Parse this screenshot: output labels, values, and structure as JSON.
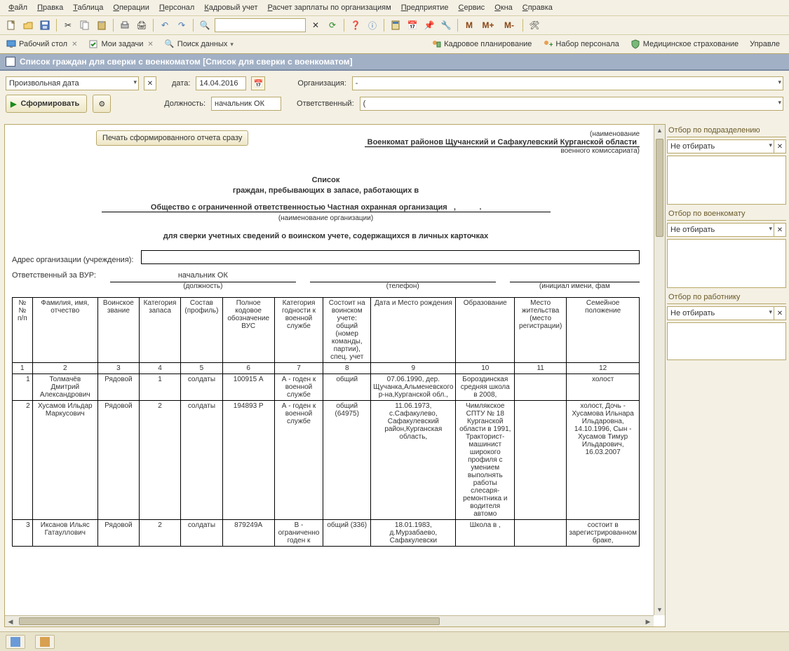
{
  "menu": [
    "Файл",
    "Правка",
    "Таблица",
    "Операции",
    "Персонал",
    "Кадровый учет",
    "Расчет зарплаты по организациям",
    "Предприятие",
    "Сервис",
    "Окна",
    "Справка"
  ],
  "nav": {
    "desktop": "Рабочий стол",
    "tasks": "Мои задачи",
    "search": "Поиск данных",
    "hr_plan": "Кадровое планирование",
    "recruit": "Набор персонала",
    "med": "Медицинское страхование",
    "manage": "Управле"
  },
  "tab_title": "Список граждан для сверки с военкоматом [Список для сверки с военкоматом]",
  "form": {
    "period_mode": "Произвольная дата",
    "date_label": "дата:",
    "date_value": "14.04.2016",
    "org_label": "Организация:",
    "org_value": "-",
    "position_label": "Должность:",
    "position_value": "начальник ОК",
    "responsible_label": "Ответственный:",
    "responsible_value": "(",
    "generate": "Сформировать",
    "print_immediately": "Печать сформированного отчета сразу"
  },
  "report": {
    "hdr_top": "(наименование",
    "hdr_main": "Военкомат районов Щучанский и Сафакулевский Курганской области",
    "hdr_sub": "военного комиссариата)",
    "title1": "Список",
    "title2": "граждан, пребывающих в запасе, работающих в",
    "org_line": "Общество с ограниченной ответственностью Частная охранная организация",
    "org_sub": "(наименование организации)",
    "title3": "для сверки учетных сведений о воинском учете, содержащихся в личных карточках",
    "addr_label": "Адрес организации (учреждения):",
    "addr_value": "",
    "resp_label": "Ответственный за ВУР:",
    "resp_position": "начальник ОК",
    "resp_position_lbl": "(должность)",
    "resp_phone_lbl": "(телефон)",
    "resp_fio_lbl": "(инициал имени, фам",
    "cols": {
      "n": "№ № п/п",
      "fio": "Фамилия, имя, отчество",
      "rank": "Воинское звание",
      "cat": "Категория запаса",
      "staff": "Состав (профиль)",
      "vus": "Полное кодовое обозначение ВУС",
      "fit": "Категория годности к военной службе",
      "account": "Состоит на воинском учете: общий (номер команды, партии), спец. учет",
      "birth": "Дата и Место рождения",
      "edu": "Образование",
      "residence": "Место жительства (место регистрации)",
      "family": "Семейное положение"
    },
    "colnums": [
      "1",
      "2",
      "3",
      "4",
      "5",
      "6",
      "7",
      "8",
      "9",
      "10",
      "11",
      "12"
    ],
    "rows": [
      {
        "n": "1",
        "fio": "Толмачёв Дмитрий Александрович",
        "rank": "Рядовой",
        "cat": "1",
        "staff": "солдаты",
        "vus": "100915 А",
        "fit": "А - годен к военной службе",
        "account": "общий",
        "birth": "07.06.1990, дер. Щучанка,Альменевского р-на,Курганской обл.,",
        "edu": "Бороздинская средняя школа в 2008,",
        "residence": "",
        "family": "холост"
      },
      {
        "n": "2",
        "fio": "Хусамов Ильдар Маркусович",
        "rank": "Рядовой",
        "cat": "2",
        "staff": "солдаты",
        "vus": "194893 Р",
        "fit": "А - годен к военной службе",
        "account": "общий (64975)",
        "birth": "11.06.1973, с.Сафакулево, Сафакулевский район,Курганская область,",
        "edu": "Чимлякское СПТУ № 18 Курганской области в 1991, Тракторист-машинист широкого профиля с умением выполнять работы слесаря-ремонтника и водителя автомо",
        "residence": "",
        "family": "холост, Дочь - Хусамова Ильнара Ильдаровна, 14.10.1996, Сын - Хусамов Тимур Ильдарович, 16.03.2007"
      },
      {
        "n": "3",
        "fio": "Иксанов Ильяс Гатауллович",
        "rank": "Рядовой",
        "cat": "2",
        "staff": "солдаты",
        "vus": "879249А",
        "fit": "В - ограниченно годен к",
        "account": "общий (336)",
        "birth": "18.01.1983, д.Мурзабаево, Сафакулевски",
        "edu": "Школа в ,",
        "residence": "",
        "family": "состоит в зарегистрированном браке,"
      }
    ]
  },
  "side": {
    "g1_title": "Отбор по подразделению",
    "g2_title": "Отбор по военкомату",
    "g3_title": "Отбор по работнику",
    "no_filter": "Не отбирать"
  },
  "toolbar_m": {
    "m": "М",
    "mp": "М+",
    "mm": "М-"
  }
}
